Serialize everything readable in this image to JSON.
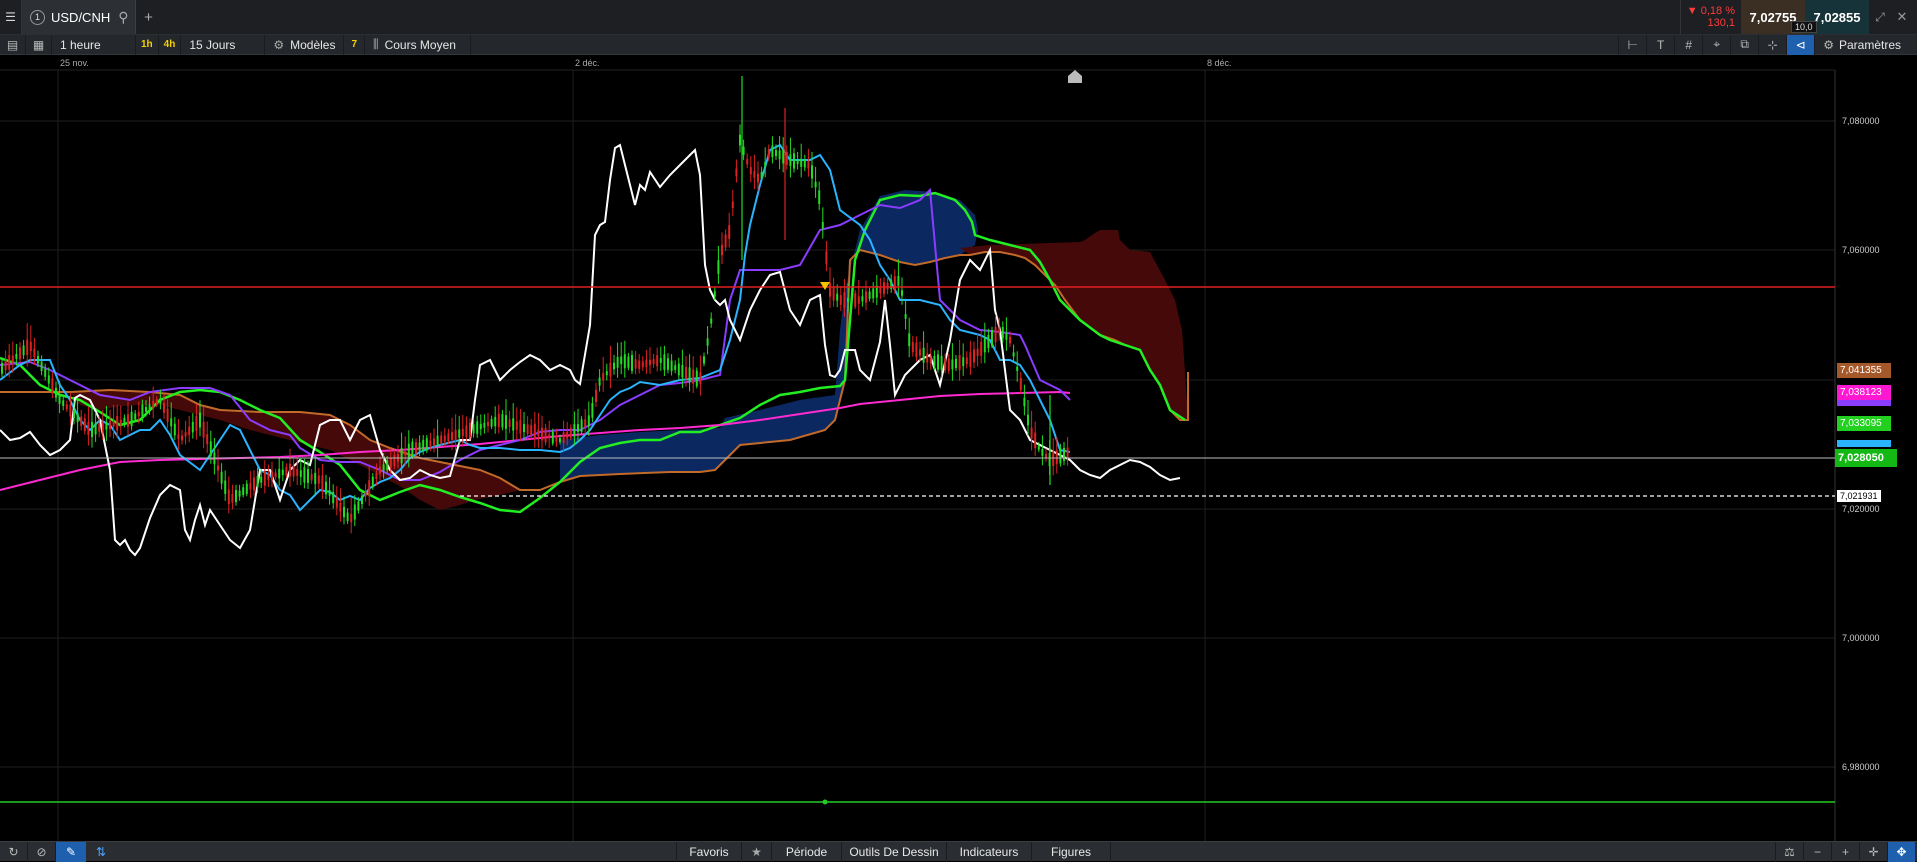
{
  "tab": {
    "index": "1",
    "symbol": "USD/CNH",
    "change_percent": "▼ 0,18 %",
    "change_points": "130,1",
    "bid": "7,02755",
    "ask": "7,02855",
    "spread": "10,0"
  },
  "toolbar": {
    "interval": "1 heure",
    "quick_1h": "1h",
    "quick_4h": "4h",
    "range": "15 Jours",
    "templates": "Modèles",
    "indicator_count": "7",
    "chart_type": "Cours Moyen",
    "settings": "Paramètres"
  },
  "x_axis": {
    "labels": [
      "25 nov.",
      "2 déc.",
      "8 déc."
    ]
  },
  "y_axis": {
    "ticks": [
      "7,080000",
      "7,060000",
      "7,020000",
      "7,000000",
      "6,980000"
    ]
  },
  "price_tags": {
    "brown": "7,041355",
    "magenta": "7,038123",
    "green": "7,033095",
    "current": "7,028050",
    "dashed": "7,021931"
  },
  "bottom": {
    "favorites": "Favoris",
    "period": "Période",
    "drawing_tools": "Outils De Dessin",
    "indicators": "Indicateurs",
    "figures": "Figures"
  },
  "colors": {
    "background": "#000000",
    "price_line": "#ffffff",
    "candle_up": "#22dd22",
    "candle_down": "#dd2222",
    "cloud_bull": "#0c2a66",
    "cloud_bear": "#4a0a0a",
    "kijun": "#8a3cff",
    "tenkan": "#2ab4ff",
    "chikou": "#ffffff",
    "senkou_a": "#22ee22",
    "senkou_b": "#c26a2a",
    "ma": "#ff2ad0",
    "resistance": "#e02020",
    "support": "#22cc22",
    "current": "#18c020"
  }
}
